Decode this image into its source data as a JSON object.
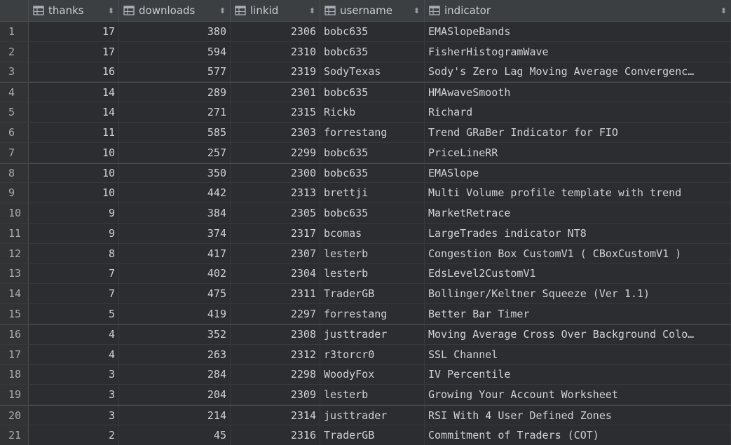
{
  "columns": [
    {
      "label": "thanks",
      "icon": "column-icon"
    },
    {
      "label": "downloads",
      "icon": "column-icon"
    },
    {
      "label": "linkid",
      "icon": "column-icon"
    },
    {
      "label": "username",
      "icon": "column-icon"
    },
    {
      "label": "indicator",
      "icon": "column-icon"
    }
  ],
  "sort_glyph": "⬍",
  "rows": [
    {
      "n": "1",
      "thanks": "17",
      "downloads": "380",
      "linkid": "2306",
      "username": "bobc635",
      "indicator": "EMASlopeBands"
    },
    {
      "n": "2",
      "thanks": "17",
      "downloads": "594",
      "linkid": "2310",
      "username": "bobc635",
      "indicator": "FisherHistogramWave"
    },
    {
      "n": "3",
      "thanks": "16",
      "downloads": "577",
      "linkid": "2319",
      "username": "SodyTexas",
      "indicator": "Sody's Zero Lag Moving Average Convergenc…"
    },
    {
      "n": "4",
      "thanks": "14",
      "downloads": "289",
      "linkid": "2301",
      "username": "bobc635",
      "indicator": "HMAwaveSmooth"
    },
    {
      "n": "5",
      "thanks": "14",
      "downloads": "271",
      "linkid": "2315",
      "username": "Rickb",
      "indicator": "Richard"
    },
    {
      "n": "6",
      "thanks": "11",
      "downloads": "585",
      "linkid": "2303",
      "username": "forrestang",
      "indicator": "Trend GRaBer Indicator for FIO"
    },
    {
      "n": "7",
      "thanks": "10",
      "downloads": "257",
      "linkid": "2299",
      "username": "bobc635",
      "indicator": "PriceLineRR"
    },
    {
      "n": "8",
      "thanks": "10",
      "downloads": "350",
      "linkid": "2300",
      "username": "bobc635",
      "indicator": "EMASlope"
    },
    {
      "n": "9",
      "thanks": "10",
      "downloads": "442",
      "linkid": "2313",
      "username": "brettji",
      "indicator": "Multi Volume profile template with trend"
    },
    {
      "n": "10",
      "thanks": "9",
      "downloads": "384",
      "linkid": "2305",
      "username": "bobc635",
      "indicator": "MarketRetrace"
    },
    {
      "n": "11",
      "thanks": "9",
      "downloads": "374",
      "linkid": "2317",
      "username": "bcomas",
      "indicator": "LargeTrades indicator NT8"
    },
    {
      "n": "12",
      "thanks": "8",
      "downloads": "417",
      "linkid": "2307",
      "username": "lesterb",
      "indicator": "Congestion Box CustomV1 ( CBoxCustomV1 )"
    },
    {
      "n": "13",
      "thanks": "7",
      "downloads": "402",
      "linkid": "2304",
      "username": "lesterb",
      "indicator": "EdsLevel2CustomV1"
    },
    {
      "n": "14",
      "thanks": "7",
      "downloads": "475",
      "linkid": "2311",
      "username": "TraderGB",
      "indicator": "Bollinger/Keltner Squeeze (Ver 1.1)"
    },
    {
      "n": "15",
      "thanks": "5",
      "downloads": "419",
      "linkid": "2297",
      "username": "forrestang",
      "indicator": "Better Bar Timer"
    },
    {
      "n": "16",
      "thanks": "4",
      "downloads": "352",
      "linkid": "2308",
      "username": "justtrader",
      "indicator": "Moving Average Cross Over Background Colo…"
    },
    {
      "n": "17",
      "thanks": "4",
      "downloads": "263",
      "linkid": "2312",
      "username": "r3torcr0",
      "indicator": "SSL Channel"
    },
    {
      "n": "18",
      "thanks": "3",
      "downloads": "284",
      "linkid": "2298",
      "username": "WoodyFox",
      "indicator": "IV Percentile"
    },
    {
      "n": "19",
      "thanks": "3",
      "downloads": "204",
      "linkid": "2309",
      "username": "lesterb",
      "indicator": "Growing Your Account Worksheet"
    },
    {
      "n": "20",
      "thanks": "3",
      "downloads": "214",
      "linkid": "2314",
      "username": "justtrader",
      "indicator": "RSI With 4 User Defined Zones"
    },
    {
      "n": "21",
      "thanks": "2",
      "downloads": "45",
      "linkid": "2316",
      "username": "TraderGB",
      "indicator": "Commitment of Traders (COT)"
    }
  ],
  "colors": {
    "background": "#2b2d30",
    "header": "#3c3f41",
    "text": "#cfd2d6",
    "gutter": "#313335"
  }
}
